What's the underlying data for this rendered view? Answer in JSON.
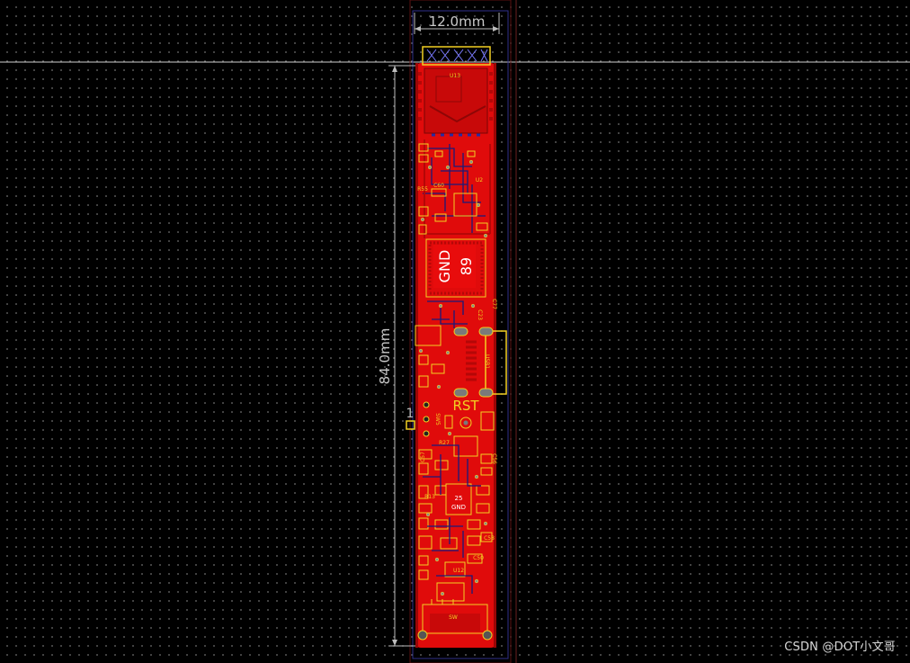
{
  "dimensions": {
    "width_label": "12.0mm",
    "height_label": "84.0mm"
  },
  "markers": {
    "pin1": "1"
  },
  "silkscreen": {
    "gnd_large": "GND",
    "gnd_number": "89",
    "rst": "RST",
    "gnd_small": "GND",
    "gnd_small_num": "25",
    "components": {
      "u13": "U13",
      "u2": "U2",
      "u12": "U12",
      "usb1": "USB1",
      "sw": "SW",
      "sw5": "SW5",
      "c60": "C60",
      "r55": "R55",
      "c57": "C57",
      "c56": "C56",
      "r27": "R27",
      "r13": "R13",
      "c58": "C58",
      "c50": "C50",
      "c77": "C77",
      "c23": "C23",
      "r31": "R31",
      "r1": "R1",
      "c2": "C2",
      "l3": "L3",
      "l5": "L5",
      "q1": "Q1",
      "q2": "Q2"
    }
  },
  "watermark": "CSDN @DOT小文哥",
  "colors": {
    "background": "#000000",
    "board_copper": "#e00b0b",
    "board_dark": "#a30606",
    "silkscreen": "#f2d023",
    "outline": "#3a3a9a",
    "dimension_line": "#bdbdbd"
  }
}
